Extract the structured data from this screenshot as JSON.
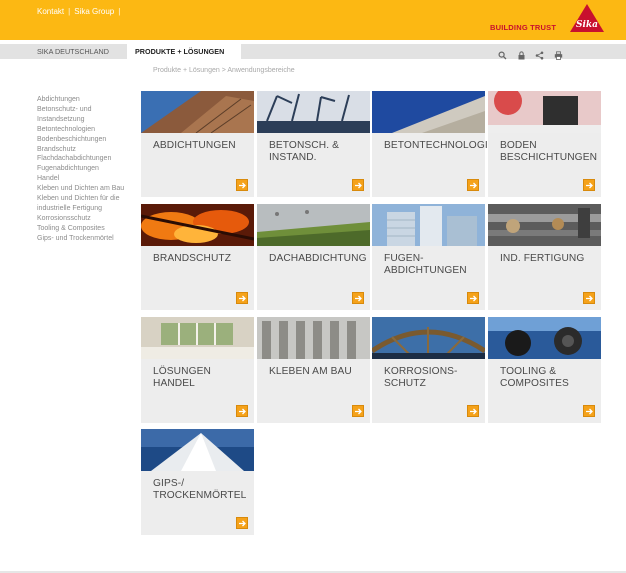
{
  "header": {
    "links": [
      "Kontakt",
      "Sika Group"
    ],
    "tagline": "BUILDING TRUST",
    "logo_text": "Sika",
    "brand_color": "#fcb813",
    "logo_color": "#c8102e"
  },
  "nav": {
    "tabs": [
      "SIKA DEUTSCHLAND",
      "PRODUKTE + LÖSUNGEN"
    ],
    "active_tab": "PRODUKTE + LÖSUNGEN",
    "icons": [
      "search-icon",
      "lock-icon",
      "share-icon",
      "print-icon"
    ]
  },
  "breadcrumb": "Produkte + Lösungen > Anwendungsbereiche",
  "sidebar": {
    "items": [
      "Abdichtungen",
      "Betonschutz- und Instandsetzung",
      "Betontechnologien",
      "Bodenbeschichtungen",
      "Brandschutz",
      "Flachdachabdichtungen",
      "Fugenabdichtungen",
      "Handel",
      "Kleben und Dichten am Bau",
      "Kleben und Dichten für die industrielle Fertigung",
      "Korrosionsschutz",
      "Tooling & Composites",
      "Gips- und Trockenmörtel"
    ]
  },
  "tiles": [
    {
      "label": "ABDICHTUNGEN",
      "icon": "arrow-right-icon"
    },
    {
      "label": "BETONSCH. & INSTAND.",
      "icon": "arrow-right-icon"
    },
    {
      "label": "BETONTECHNOLOGIE",
      "icon": "arrow-right-icon"
    },
    {
      "label": "BODEN BESCHICHTUNGEN",
      "icon": "arrow-right-icon"
    },
    {
      "label": "BRANDSCHUTZ",
      "icon": "arrow-right-icon"
    },
    {
      "label": "DACHABDICHTUNG",
      "icon": "arrow-right-icon"
    },
    {
      "label": "FUGEN-ABDICHTUNGEN",
      "icon": "arrow-right-icon"
    },
    {
      "label": "IND. FERTIGUNG",
      "icon": "arrow-right-icon"
    },
    {
      "label": "LÖSUNGEN HANDEL",
      "icon": "arrow-right-icon"
    },
    {
      "label": "KLEBEN AM BAU",
      "icon": "arrow-right-icon"
    },
    {
      "label": "KORROSIONS-SCHUTZ",
      "icon": "arrow-right-icon"
    },
    {
      "label": "TOOLING & COMPOSITES",
      "icon": "arrow-right-icon"
    },
    {
      "label": "GIPS-/ TROCKENMÖRTEL",
      "icon": "arrow-right-icon"
    }
  ]
}
